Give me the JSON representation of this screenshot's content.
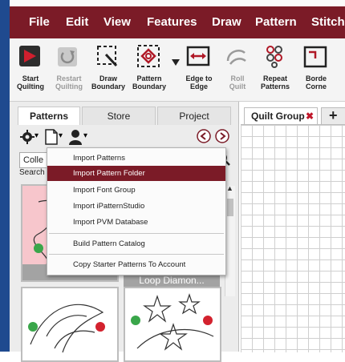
{
  "menubar": {
    "items": [
      "File",
      "Edit",
      "View",
      "Features",
      "Draw",
      "Pattern",
      "Stitch"
    ]
  },
  "toolbar": {
    "buttons": [
      {
        "label": "Start\nQuilting",
        "icon": "play-icon",
        "enabled": true
      },
      {
        "label": "Restart\nQuilting",
        "icon": "restart-icon",
        "enabled": false
      },
      {
        "label": "Draw\nBoundary",
        "icon": "draw-boundary-icon",
        "enabled": true
      },
      {
        "label": "Pattern\nBoundary",
        "icon": "pattern-boundary-icon",
        "enabled": true
      },
      {
        "label": "Edge to\nEdge",
        "icon": "edge-to-edge-icon",
        "enabled": true
      },
      {
        "label": "Roll\nQuilt",
        "icon": "roll-quilt-icon",
        "enabled": false
      },
      {
        "label": "Repeat\nPatterns",
        "icon": "repeat-patterns-icon",
        "enabled": true
      },
      {
        "label": "Borde\nCorne",
        "icon": "border-corner-icon",
        "enabled": true
      }
    ]
  },
  "left_panel": {
    "tabs": [
      "Patterns",
      "Store",
      "Project"
    ],
    "active_tab": "Patterns",
    "collection_value": "Colle",
    "search_label": "Search",
    "search_link": "rch",
    "thumbnails": [
      {
        "label": "ma"
      },
      {
        "label": "Loop Diamon..."
      },
      {
        "label": ""
      },
      {
        "label": ""
      }
    ]
  },
  "dropdown_menu": {
    "items": [
      {
        "label": "Import Patterns",
        "selected": false
      },
      {
        "label": "Import Pattern Folder",
        "selected": true
      },
      {
        "label": "Import Font Group",
        "selected": false
      },
      {
        "label": "Import iPatternStudio",
        "selected": false
      },
      {
        "label": "Import PVM Database",
        "selected": false
      },
      {
        "label": "Build Pattern Catalog",
        "selected": false
      },
      {
        "label": "Copy Starter Patterns To Account",
        "selected": false
      }
    ]
  },
  "right_panel": {
    "tab_label": "Quilt Group",
    "close_glyph": "✖",
    "add_glyph": "+"
  },
  "colors": {
    "accent": "#7b1b27",
    "menu_highlight": "#7b1b27",
    "link": "#1a4fd6",
    "pin_green": "#3aa64a",
    "pin_red": "#d3222e"
  }
}
